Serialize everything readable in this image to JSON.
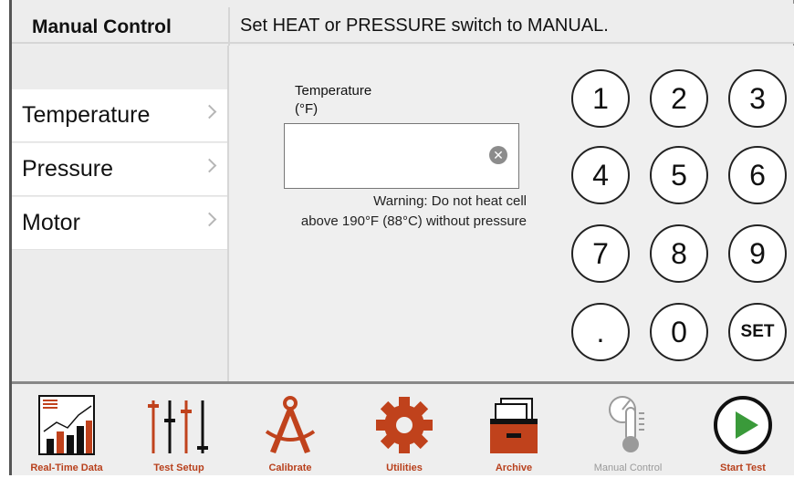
{
  "header": {
    "title": "Manual Control",
    "message": "Set HEAT or PRESSURE switch to MANUAL."
  },
  "sidebar": {
    "items": [
      {
        "label": "Temperature"
      },
      {
        "label": "Pressure"
      },
      {
        "label": "Motor"
      }
    ]
  },
  "main": {
    "field_label_line1": "Temperature",
    "field_label_line2": "(°F)",
    "field_value": "",
    "warning_line1": "Warning: Do not heat cell",
    "warning_line2": "above 190°F (88°C) without pressure"
  },
  "keypad": {
    "keys": [
      "1",
      "2",
      "3",
      "4",
      "5",
      "6",
      "7",
      "8",
      "9",
      ".",
      "0",
      "SET"
    ]
  },
  "nav": {
    "items": [
      {
        "label": "Real-Time Data",
        "icon": "chart-icon"
      },
      {
        "label": "Test Setup",
        "icon": "sliders-icon"
      },
      {
        "label": "Calibrate",
        "icon": "compass-icon"
      },
      {
        "label": "Utilities",
        "icon": "gear-icon"
      },
      {
        "label": "Archive",
        "icon": "file-cabinet-icon"
      },
      {
        "label": "Manual Control",
        "icon": "thermometer-gauge-icon"
      },
      {
        "label": "Start Test",
        "icon": "play-icon"
      }
    ]
  },
  "colors": {
    "accent": "#c0421c",
    "disabled": "#9a9a9a",
    "play": "#3a9a3a"
  }
}
